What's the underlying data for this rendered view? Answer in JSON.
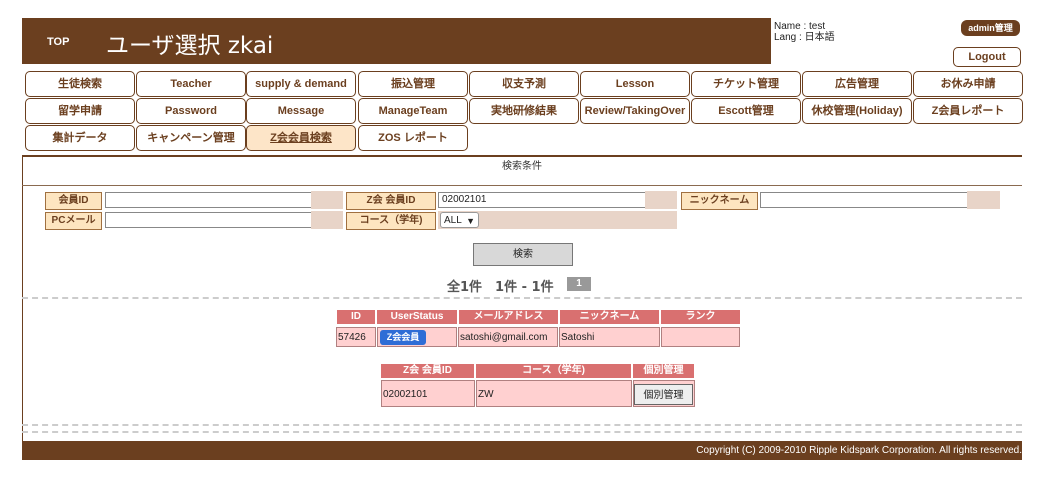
{
  "header": {
    "top_link": "TOP",
    "title": "ユーザ選択 zkai",
    "user_name": "Name : test",
    "user_lang": "Lang : 日本語",
    "admin_badge": "admin管理",
    "logout": "Logout"
  },
  "nav": [
    "生徒検索",
    "Teacher",
    "supply & demand",
    "振込管理",
    "収支予測",
    "Lesson",
    "チケット管理",
    "広告管理",
    "お休み申請",
    "留学申請",
    "Password",
    "Message",
    "ManageTeam",
    "実地研修結果",
    "Review/TakingOver",
    "Escott管理",
    "休校管理(Holiday)",
    "Z会員レポート",
    "集計データ",
    "キャンペーン管理",
    "Z会会員検索",
    "ZOS レポート"
  ],
  "active_nav_index": 20,
  "search": {
    "header": "検索条件",
    "member_id_label": "会員ID",
    "member_id_value": "",
    "zkai_id_label": "Z会 会員ID",
    "zkai_id_value": "02002101",
    "nickname_label": "ニックネーム",
    "nickname_value": "",
    "pc_mail_label": "PCメール",
    "pc_mail_value": "",
    "course_label": "コース（学年)",
    "course_value": "ALL",
    "search_button": "検索"
  },
  "results": {
    "count_text": "全1件　1件 - 1件",
    "page": "1",
    "table1": {
      "headers": [
        "ID",
        "UserStatus",
        "メールアドレス",
        "ニックネーム",
        "ランク"
      ],
      "row": {
        "id": "57426",
        "status": "Z会会員",
        "email": "satoshi@gmail.com",
        "nickname": "Satoshi",
        "rank": ""
      }
    },
    "table2": {
      "headers": [
        "Z会 会員ID",
        "コース（学年)",
        "個別管理"
      ],
      "row": {
        "zkai_id": "02002101",
        "course": "ZW",
        "manage_button": "個別管理"
      }
    }
  },
  "footer": "Copyright (C) 2009-2010 Ripple Kidspark Corporation. All rights reserved.",
  "colors": {
    "brand": "#6b3f1f",
    "label_bg": "#fde5c0",
    "table_header": "#d97070",
    "table_cell": "#ffd0d0",
    "status_badge": "#2e6dd6"
  }
}
